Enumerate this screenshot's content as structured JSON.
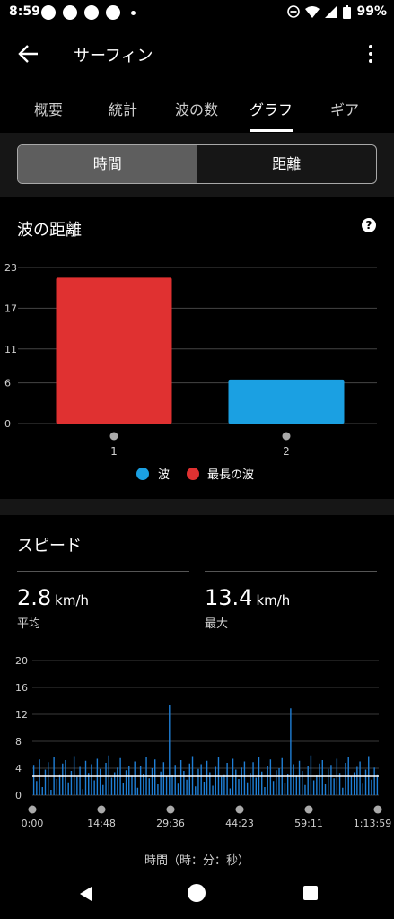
{
  "status_bar": {
    "time": "8:59",
    "battery": "99%"
  },
  "app_bar": {
    "title": "サーフィン"
  },
  "tabs": [
    {
      "label": "概要",
      "active": false
    },
    {
      "label": "統計",
      "active": false
    },
    {
      "label": "波の数",
      "active": false
    },
    {
      "label": "グラフ",
      "active": true
    },
    {
      "label": "ギア",
      "active": false
    }
  ],
  "segment": {
    "time_label": "時間",
    "distance_label": "距離",
    "selected": "time"
  },
  "colors": {
    "wave": "#1ba0e2",
    "longest_wave": "#e03131",
    "speed_line": "#1f7fd6"
  },
  "wave_distance": {
    "title": "波の距離",
    "legend": {
      "wave": "波",
      "longest_wave": "最長の波"
    }
  },
  "speed": {
    "title": "スピード",
    "average": {
      "value": "2.8",
      "unit": "km/h",
      "label": "平均"
    },
    "max": {
      "value": "13.4",
      "unit": "km/h",
      "label": "最大"
    },
    "x_caption": "時間（時：分：秒）"
  },
  "chart_data": [
    {
      "type": "bar",
      "title": "波の距離",
      "categories": [
        "1",
        "2"
      ],
      "series": [
        {
          "name": "波",
          "values": [
            null,
            6.5
          ]
        },
        {
          "name": "最長の波",
          "values": [
            21.5,
            null
          ]
        }
      ],
      "y_ticks": [
        "0",
        "6",
        "11",
        "17",
        "23"
      ],
      "ylim": [
        0,
        23
      ],
      "grid": true,
      "legend_position": "bottom"
    },
    {
      "type": "bar",
      "title": "スピード",
      "x_ticks": [
        "0:00",
        "14:48",
        "29:36",
        "44:23",
        "59:11",
        "1:13:59"
      ],
      "y_ticks": [
        "0",
        "4",
        "8",
        "12",
        "16",
        "20"
      ],
      "ylim": [
        0,
        20
      ],
      "average": 2.8,
      "max": 13.4,
      "grid": true,
      "values": [
        4.5,
        2.1,
        5.3,
        1.2,
        3.8,
        4.9,
        0.8,
        5.6,
        2.4,
        3.1,
        4.7,
        5.2,
        1.9,
        3.6,
        5.8,
        2.7,
        4.2,
        0.9,
        5.1,
        3.3,
        4.6,
        2.2,
        5.4,
        3.9,
        1.5,
        4.8,
        5.9,
        2.6,
        3.4,
        4.1,
        5.5,
        1.8,
        3.7,
        4.4,
        2.9,
        5.0,
        1.1,
        4.3,
        3.2,
        5.7,
        2.5,
        4.0,
        5.3,
        1.6,
        3.5,
        4.9,
        2.8,
        13.4,
        3.0,
        4.5,
        1.7,
        5.2,
        3.6,
        2.3,
        4.7,
        5.8,
        1.3,
        3.9,
        4.6,
        2.0,
        5.1,
        3.4,
        1.4,
        4.2,
        5.6,
        2.7,
        3.1,
        4.8,
        1.0,
        5.4,
        3.8,
        2.4,
        4.1,
        5.0,
        1.9,
        3.3,
        4.9,
        2.6,
        5.7,
        3.5,
        1.2,
        4.4,
        5.3,
        2.1,
        3.7,
        4.0,
        5.5,
        1.8,
        3.2,
        12.9,
        4.6,
        2.9,
        5.1,
        3.6,
        1.5,
        4.3,
        5.9,
        2.2,
        3.0,
        4.7,
        5.2,
        1.6,
        3.9,
        4.5,
        2.5,
        5.4,
        3.3,
        1.1,
        4.8,
        5.6,
        2.8,
        3.4,
        4.2,
        5.0,
        1.7,
        3.8,
        5.8,
        2.3,
        4.1,
        3.1
      ]
    }
  ],
  "nav": {
    "back": "back-icon",
    "home": "home-icon",
    "recent": "recent-apps-icon"
  }
}
